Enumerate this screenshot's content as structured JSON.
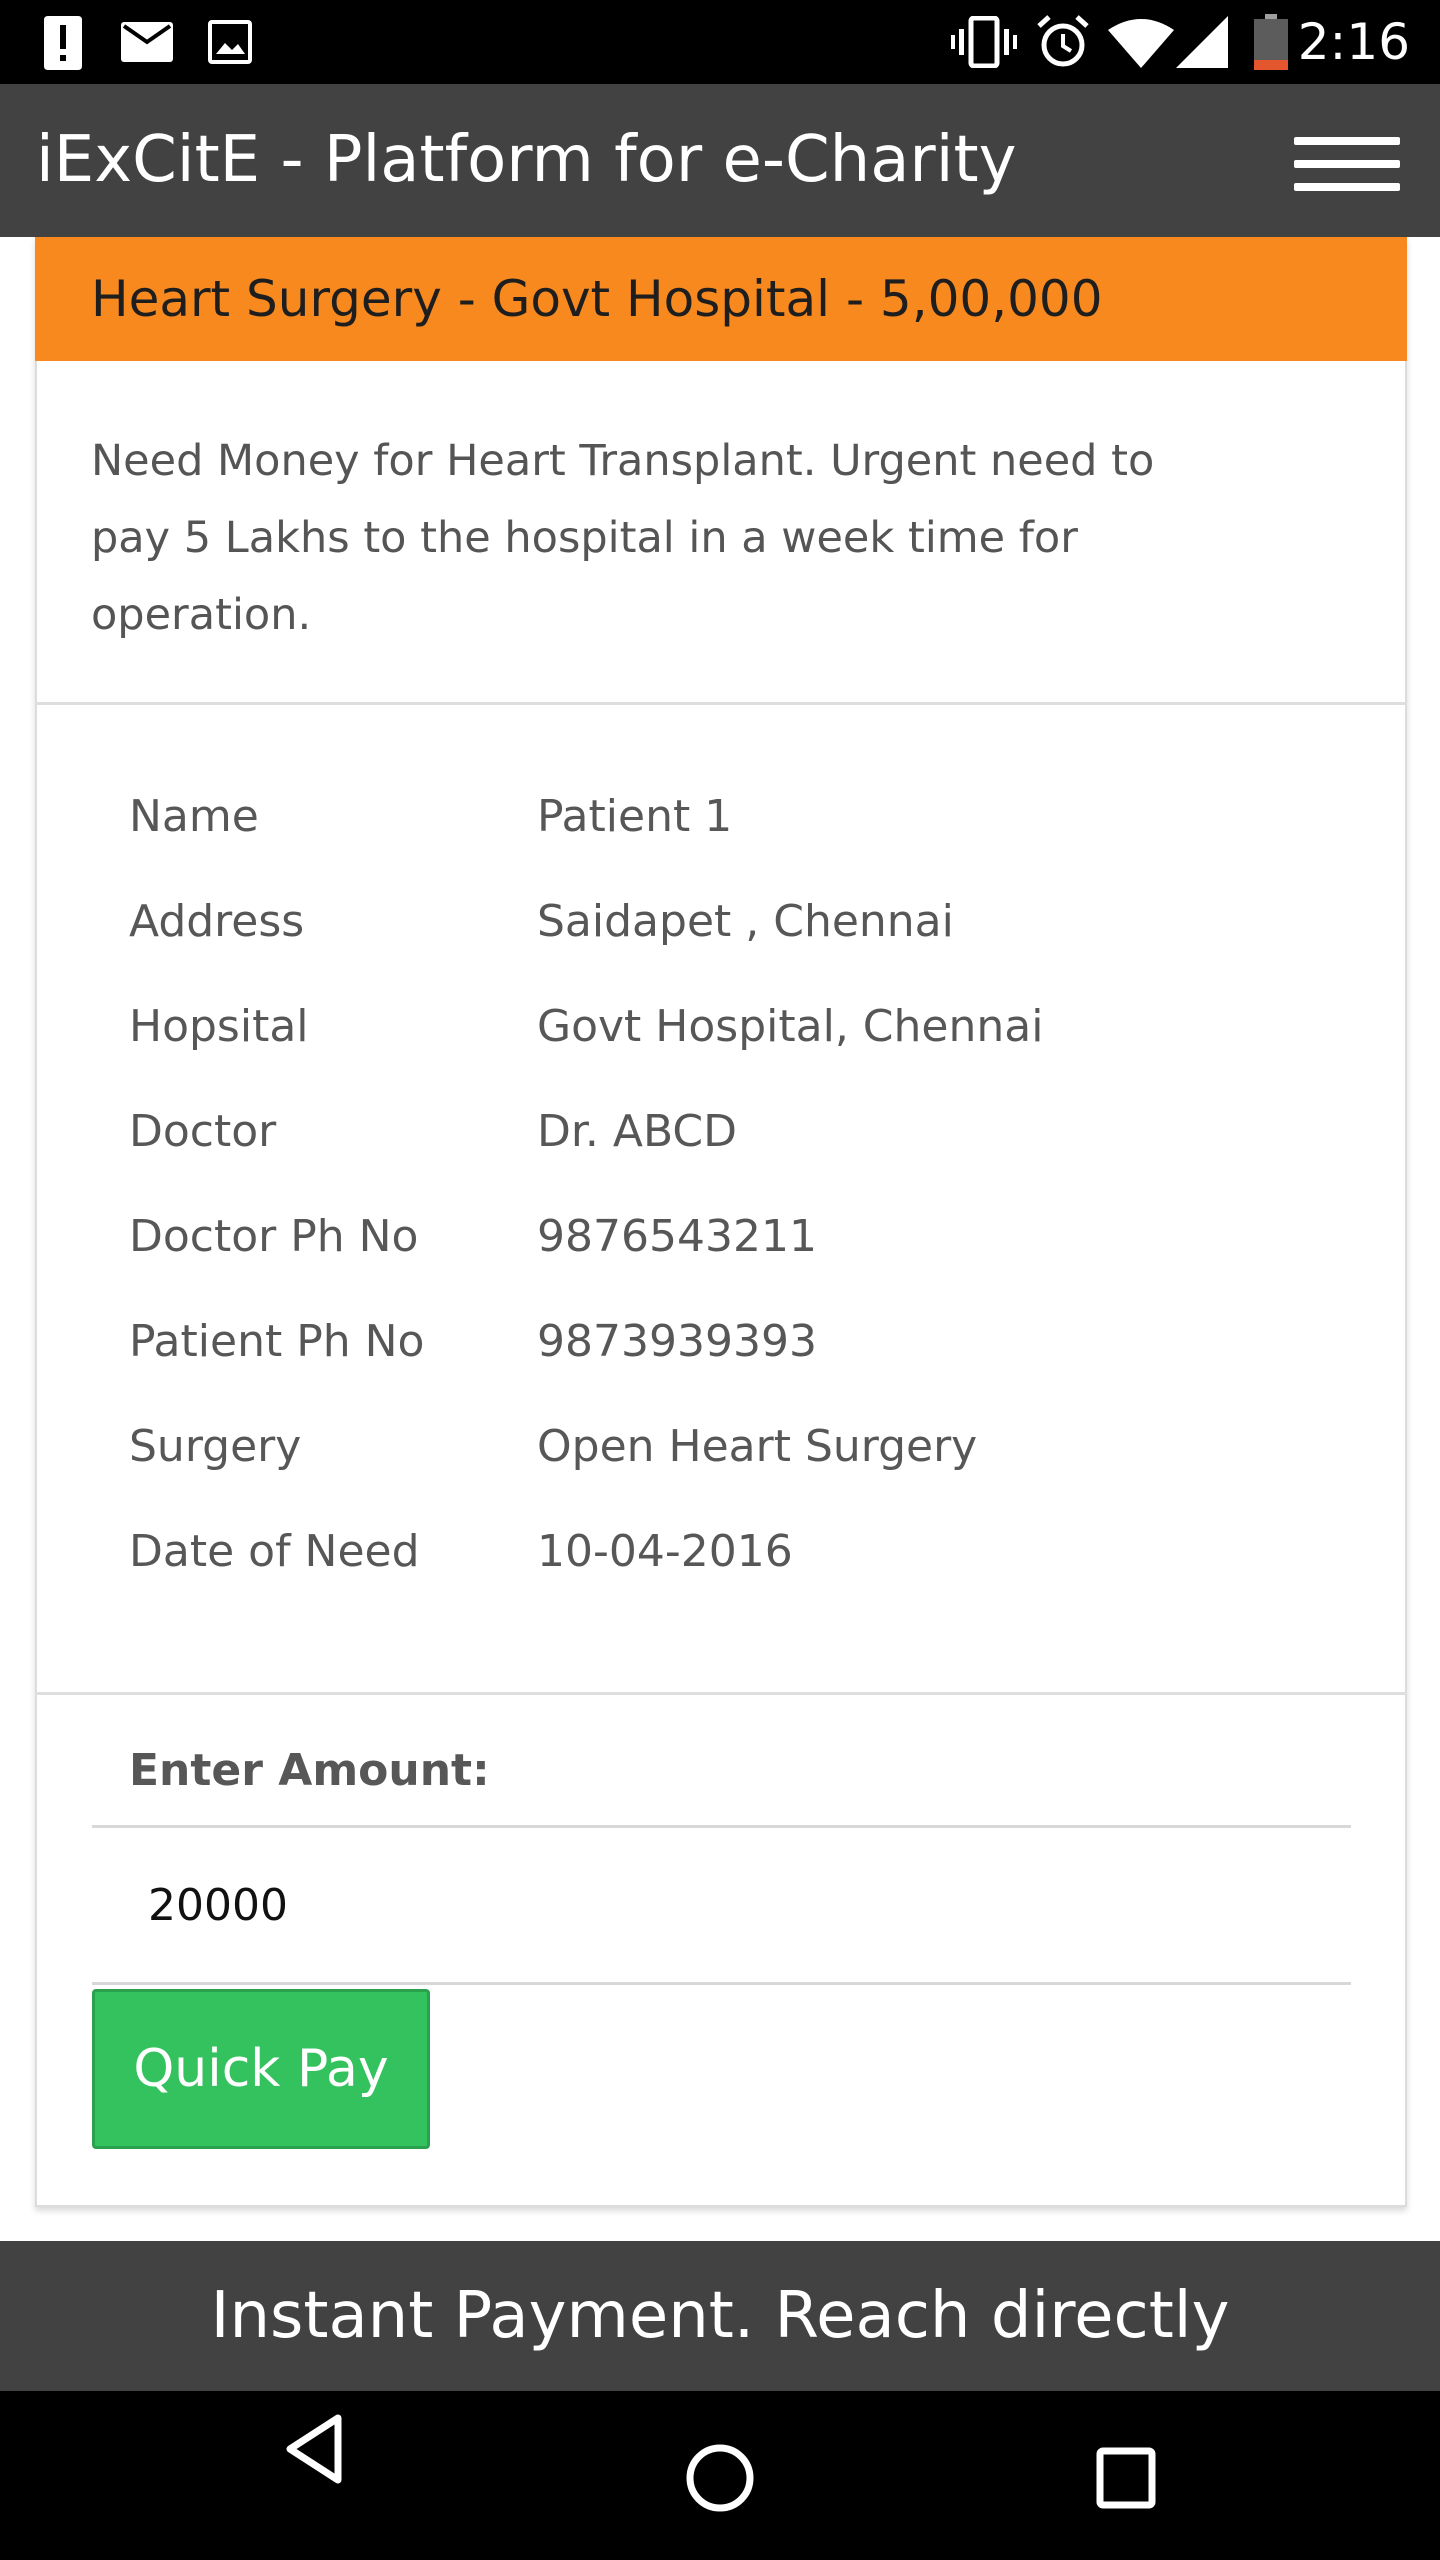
{
  "status_bar": {
    "time": "2:16",
    "left_icons": [
      "alert-icon",
      "mail-icon",
      "image-icon"
    ],
    "right_icons": [
      "vibrate-icon",
      "alarm-icon",
      "wifi-icon",
      "cell-signal-icon",
      "battery-icon"
    ]
  },
  "app_bar": {
    "title": "iExCitE - Platform for e-Charity",
    "menu_icon": "hamburger-menu-icon"
  },
  "card": {
    "header": "Heart Surgery - Govt Hospital - 5,00,000",
    "description": "Need Money for Heart Transplant. Urgent need to pay 5 Lakhs to the hospital in a week time for operation.",
    "details": [
      {
        "label": "Name",
        "value": "Patient 1"
      },
      {
        "label": "Address",
        "value": "Saidapet , Chennai"
      },
      {
        "label": "Hopsital",
        "value": "Govt Hospital, Chennai"
      },
      {
        "label": "Doctor",
        "value": "Dr. ABCD"
      },
      {
        "label": "Doctor Ph No",
        "value": "9876543211"
      },
      {
        "label": "Patient Ph No",
        "value": "9873939393"
      },
      {
        "label": "Surgery",
        "value": "Open Heart Surgery"
      },
      {
        "label": "Date of Need",
        "value": "10-04-2016"
      }
    ],
    "amount_label": "Enter Amount:",
    "amount_value": "20000",
    "pay_button": "Quick Pay"
  },
  "footer": {
    "text": "Instant Payment. Reach directly"
  },
  "nav_bar": {
    "icons": [
      "back-icon",
      "home-icon",
      "recents-icon"
    ]
  },
  "colors": {
    "status_bar": "#000000",
    "app_bar": "#424242",
    "card_header": "#f7891f",
    "pay_button": "#34c25e",
    "text": "#575757"
  }
}
